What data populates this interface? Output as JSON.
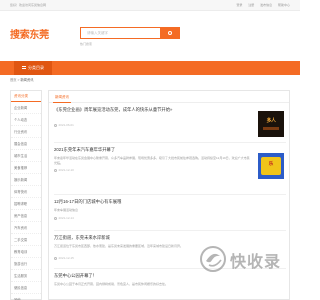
{
  "topbar": {
    "welcome": "您好！欢迎访问东莞信息网",
    "links": [
      "登录",
      "注册",
      "发布信息",
      "帮助中心"
    ]
  },
  "header": {
    "logo": "搜索东莞",
    "search_placeholder": "请输入关键字",
    "search_button": "搜索",
    "hotwords": "热门搜索"
  },
  "nav": {
    "active_item": "分类目录"
  },
  "breadcrumb": {
    "home": "首页",
    "sep": ">",
    "current": "新闻资讯"
  },
  "sidebar": {
    "title": "资讯分类",
    "categories": [
      "企业新闻",
      "个人动态",
      "行业资讯",
      "展会信息",
      "城市生活",
      "美食推荐",
      "娱乐新闻",
      "体育快讯",
      "招聘求职",
      "房产信息",
      "汽车资讯",
      "二手交易",
      "教育培训",
      "旅游出行",
      "生活服务",
      "便民信息",
      "其他"
    ]
  },
  "main": {
    "tab": "新闻资讯",
    "articles": [
      {
        "title": "《东莞企业画》周年展览活动东莞，成年人的快乐从童节开始»",
        "summary": "",
        "date": "2021-06-01",
        "thumb": "game-1"
      },
      {
        "title": "2021东莞年末汽车嘉年华开幕了",
        "summary": "年末嘉年华活动在东莞会展中心隆重开幕，众多汽车品牌参展，现场优惠多多，吸引了大批市民前往参观选购。活动持续至12月19日，欢迎广大市民光临。",
        "date": "2021-12-10",
        "thumb": "game-2"
      },
      {
        "title": "12月16-17日的门店城中心有车展哦",
        "summary": "年末车展活动信息",
        "date": "2021-12-14",
        "thumb": ""
      },
      {
        "title": "万江街道，东莞未来水岸新城",
        "summary": "万江街道位于东莞市区西部，依水而建，是东莞未来发展的重要区域，近年来城市建设日新月异。",
        "date": "2021-12-15",
        "thumb": ""
      },
      {
        "title": "东莞中心公园开幕了！",
        "summary": "东莞中心公园于本月正式开幕，园内绿树成荫、景色宜人，是市民休闲娱乐的好去处。",
        "date": "2021-12-16",
        "thumb": ""
      }
    ]
  },
  "watermark": {
    "text": "快收录"
  },
  "colors": {
    "accent": "#f46b24",
    "accent_dark": "#e05612"
  }
}
